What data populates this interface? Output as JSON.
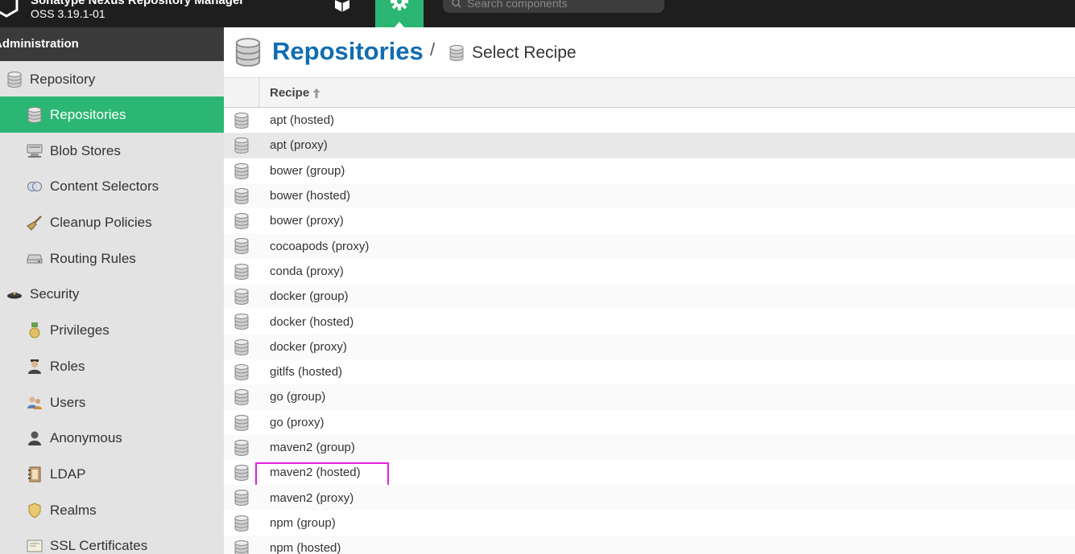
{
  "header": {
    "app_name": "Sonatype Nexus Repository Manager",
    "version": "OSS 3.19.1-01",
    "search_placeholder": "Search components",
    "accent": "#2bb673"
  },
  "sidebar": {
    "title": "Administration",
    "items": [
      {
        "label": "Repository",
        "icon": "database-icon",
        "level": 0
      },
      {
        "label": "Repositories",
        "icon": "database-icon",
        "level": 1,
        "active": true
      },
      {
        "label": "Blob Stores",
        "icon": "server-icon",
        "level": 1
      },
      {
        "label": "Content Selectors",
        "icon": "content-selector-icon",
        "level": 1
      },
      {
        "label": "Cleanup Policies",
        "icon": "broom-icon",
        "level": 1
      },
      {
        "label": "Routing Rules",
        "icon": "drive-icon",
        "level": 1
      },
      {
        "label": "Security",
        "icon": "security-cap-icon",
        "level": 0
      },
      {
        "label": "Privileges",
        "icon": "medal-icon",
        "level": 1
      },
      {
        "label": "Roles",
        "icon": "user-role-icon",
        "level": 1
      },
      {
        "label": "Users",
        "icon": "users-icon",
        "level": 1
      },
      {
        "label": "Anonymous",
        "icon": "anonymous-user-icon",
        "level": 1
      },
      {
        "label": "LDAP",
        "icon": "address-book-icon",
        "level": 1
      },
      {
        "label": "Realms",
        "icon": "shield-icon",
        "level": 1
      },
      {
        "label": "SSL Certificates",
        "icon": "certificate-icon",
        "level": 1
      }
    ]
  },
  "breadcrumb": {
    "title": "Repositories",
    "separator": "/",
    "current": "Select Recipe"
  },
  "grid": {
    "column_header": "Recipe",
    "sort": "ascending",
    "rows": [
      "apt (hosted)",
      "apt (proxy)",
      "bower (group)",
      "bower (hosted)",
      "bower (proxy)",
      "cocoapods (proxy)",
      "conda (proxy)",
      "docker (group)",
      "docker (hosted)",
      "docker (proxy)",
      "gitlfs (hosted)",
      "go (group)",
      "go (proxy)",
      "maven2 (group)",
      "maven2 (hosted)",
      "maven2 (proxy)",
      "npm (group)",
      "npm (hosted)"
    ],
    "hovered_row": "apt (proxy)",
    "highlighted_row": "maven2 (hosted)",
    "highlight_color": "#e020e0"
  }
}
